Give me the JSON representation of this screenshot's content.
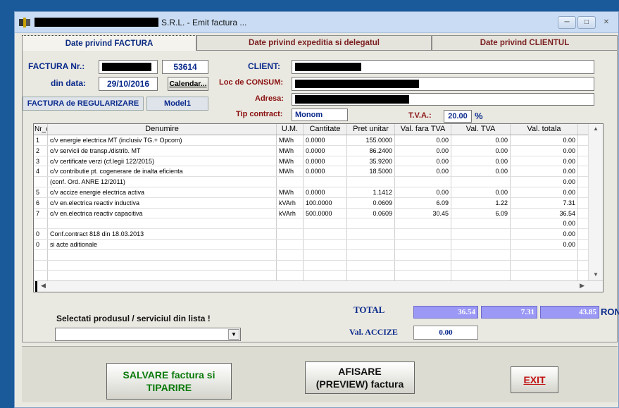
{
  "window": {
    "title": "S.R.L.  -  Emit factura ..."
  },
  "tabs": [
    {
      "label": "Date privind FACTURA"
    },
    {
      "label": "Date privind expeditia si delegatul"
    },
    {
      "label": "Date privind CLIENTUL"
    }
  ],
  "invoice": {
    "number_label": "FACTURA Nr.:",
    "number": "53614",
    "date_label": "din data:",
    "date": "29/10/2016",
    "calendar_button": "Calendar...",
    "type_button": "FACTURA de REGULARIZARE",
    "model_button": "Model1"
  },
  "client": {
    "client_label": "CLIENT:",
    "consum_label": "Loc de CONSUM:",
    "address_label": "Adresa:",
    "contract_label": "Tip contract:",
    "contract_value": "Monom",
    "tva_label": "T.V.A.:",
    "tva_value": "20.00",
    "tva_unit": "%"
  },
  "table": {
    "headers": [
      "Nr_crt",
      "Denumire",
      "U.M.",
      "Cantitate",
      "Pret unitar",
      "Val. fara TVA",
      "Val. TVA",
      "Val. totala"
    ],
    "rows": [
      [
        "1",
        "c/v energie electrica MT (inclusiv TG.+ Opcom)",
        "MWh",
        "0.0000",
        "155.0000",
        "0.00",
        "0.00",
        "0.00"
      ],
      [
        "2",
        "c/v servicii de transp./distrib. MT",
        "MWh",
        "0.0000",
        "86.2400",
        "0.00",
        "0.00",
        "0.00"
      ],
      [
        "3",
        "c/v certificate verzi (cf.legii 122/2015)",
        "MWh",
        "0.0000",
        "35.9200",
        "0.00",
        "0.00",
        "0.00"
      ],
      [
        "4",
        "c/v contributie pt. cogenerare de inalta eficienta",
        "MWh",
        "0.0000",
        "18.5000",
        "0.00",
        "0.00",
        "0.00"
      ],
      [
        "",
        "(conf. Ord. ANRE 12/2011)",
        "",
        "",
        "",
        "",
        "",
        "0.00"
      ],
      [
        "5",
        "c/v accize energie electrica activa",
        "MWh",
        "0.0000",
        "1.1412",
        "0.00",
        "0.00",
        "0.00"
      ],
      [
        "6",
        "c/v en.electrica reactiv inductiva",
        "kVArh",
        "100.0000",
        "0.0609",
        "6.09",
        "1.22",
        "7.31"
      ],
      [
        "7",
        "c/v en.electrica reactiv capacitiva",
        "kVArh",
        "500.0000",
        "0.0609",
        "30.45",
        "6.09",
        "36.54"
      ],
      [
        "",
        "",
        "",
        "",
        "",
        "",
        "",
        "0.00"
      ],
      [
        "0",
        "Conf.contract 818 din  18.03.2013",
        "",
        "",
        "",
        "",
        "",
        "0.00"
      ],
      [
        "0",
        "si acte aditionale",
        "",
        "",
        "",
        "",
        "",
        "0.00"
      ],
      [
        "",
        "",
        "",
        "",
        "",
        "",
        "",
        ""
      ],
      [
        "",
        "",
        "",
        "",
        "",
        "",
        "",
        ""
      ],
      [
        "",
        "",
        "",
        "",
        "",
        "",
        "",
        ""
      ],
      [
        "",
        "",
        "",
        "",
        "",
        "",
        "",
        ""
      ]
    ]
  },
  "totals": {
    "total_label": "TOTAL",
    "fara_tva": "36.54",
    "tva": "7.31",
    "total": "43.85",
    "currency": "RON",
    "accize_label": "Val. ACCIZE",
    "accize_value": "0.00"
  },
  "product": {
    "label": "Selectati produsul / serviciul din lista !",
    "selected": ""
  },
  "buttons": {
    "save_line1": "SALVARE factura si",
    "save_line2": "TIPARIRE",
    "preview_line1": "AFISARE",
    "preview_line2": "(PREVIEW) factura",
    "exit": "EXIT"
  },
  "colors": {
    "accent_blue": "#0a2a8c",
    "total_fill": "#9b99f5",
    "label_red": "#8a1010"
  }
}
